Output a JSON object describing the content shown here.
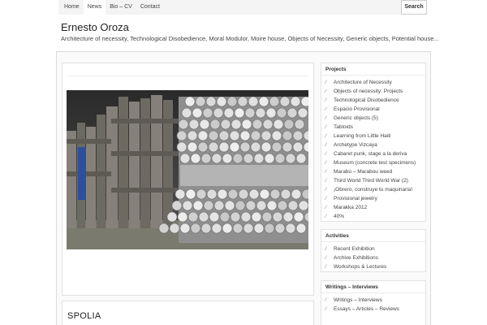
{
  "nav": {
    "items": [
      "Home",
      "News",
      "Bio – CV",
      "Contact"
    ],
    "search_label": "Search"
  },
  "header": {
    "title": "Ernesto Oroza",
    "description": "Architecture of necessity, Technological Disobedience, Moral Modulor, Moire house, Objects of Necessity, Generic objects, Potential house..."
  },
  "posts": [
    {
      "title": ""
    },
    {
      "title": "SPOLIA"
    }
  ],
  "sidebar": {
    "projects": {
      "title": "Projects",
      "items": [
        "Architecture of Necessity",
        "Objects of necessity: Projects",
        "Technological Disobedience",
        "Espacio Provisional",
        "Generic objects (5)",
        "Tabloids",
        "Learning from Little Haiti",
        "Archetype Vizcaya",
        "Cabaret punk, stage a la deriva",
        "Museum (concrete test specimens)",
        "Marabú – Marabou weed",
        "Third World Third World War (2)",
        "¡Obrero, construye tu maquinaria!",
        "Provisional jewelry",
        "Marakka 2012",
        "40%"
      ]
    },
    "activities": {
      "title": "Activities",
      "items": [
        "Recent Exhibition",
        "Archive Exhibitions",
        "Workshops & Lectures"
      ]
    },
    "writings": {
      "title": "Writings – Interviews",
      "items": [
        "Writings – Interviews",
        "Essays – Articles – Reviews"
      ]
    }
  },
  "colors": {
    "nav_bg": "#f4f4f4",
    "border": "#dcdcdc",
    "text": "#333333"
  }
}
